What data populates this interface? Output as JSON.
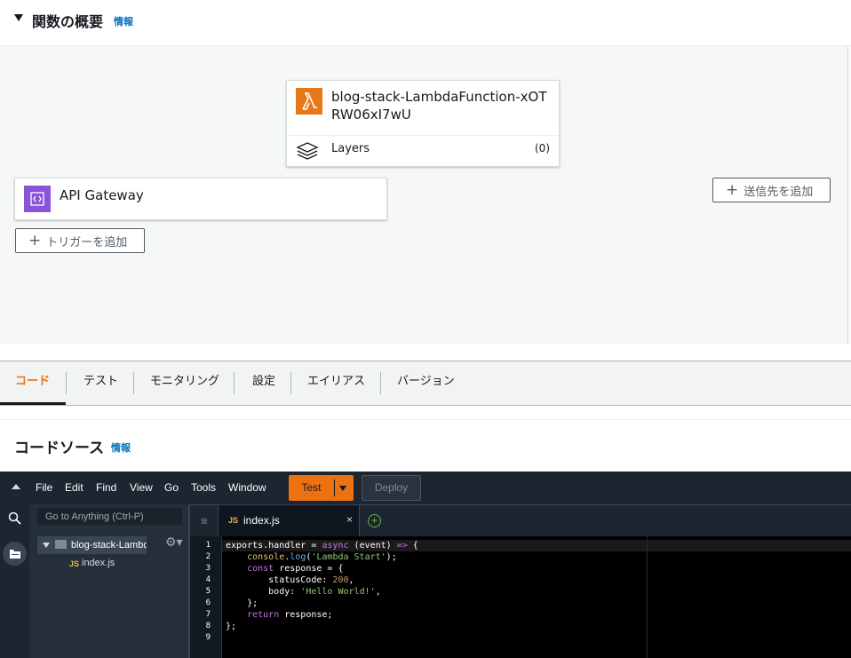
{
  "overview": {
    "title": "関数の概要",
    "info": "情報"
  },
  "function_card": {
    "name": "blog-stack-LambdaFunction-xOTRW06xI7wU",
    "layers_label": "Layers",
    "layers_count": "(0)"
  },
  "trigger_card": {
    "label": "API Gateway"
  },
  "buttons": {
    "add_trigger": "トリガーを追加",
    "add_destination": "送信先を追加"
  },
  "tabs": [
    {
      "label": "コード"
    },
    {
      "label": "テスト"
    },
    {
      "label": "モニタリング"
    },
    {
      "label": "設定"
    },
    {
      "label": "エイリアス"
    },
    {
      "label": "バージョン"
    }
  ],
  "code_source": {
    "title": "コードソース",
    "info": "情報"
  },
  "ide": {
    "menu": [
      "File",
      "Edit",
      "Find",
      "View",
      "Go",
      "Tools",
      "Window"
    ],
    "test_label": "Test",
    "deploy_label": "Deploy",
    "goto_placeholder": "Go to Anything (Ctrl-P)",
    "tree": {
      "folder": "blog-stack-Lambd",
      "file_badge": "JS",
      "file": "index.js"
    },
    "editor_tab": {
      "badge": "JS",
      "label": "index.js",
      "close": "×"
    },
    "code": {
      "line_numbers": [
        "1",
        "2",
        "3",
        "4",
        "5",
        "6",
        "7",
        "8",
        "9"
      ],
      "l1": {
        "a": "exports.handler = ",
        "b": "async",
        "c": " (event) ",
        "d": "=>",
        "e": " {"
      },
      "l2": {
        "a": "    ",
        "b": "console",
        "c": ".",
        "d": "log",
        "e": "(",
        "f": "'Lambda Start'",
        "g": ");"
      },
      "l3": {
        "a": "    ",
        "b": "const",
        "c": " response = {"
      },
      "l4": {
        "a": "        statusCode: ",
        "b": "200",
        "c": ","
      },
      "l5": {
        "a": "        body: ",
        "b": "'Hello World!'",
        "c": ","
      },
      "l6": {
        "a": "    };"
      },
      "l7": {
        "a": "    ",
        "b": "return",
        "c": " response;"
      },
      "l8": {
        "a": "};"
      }
    }
  }
}
